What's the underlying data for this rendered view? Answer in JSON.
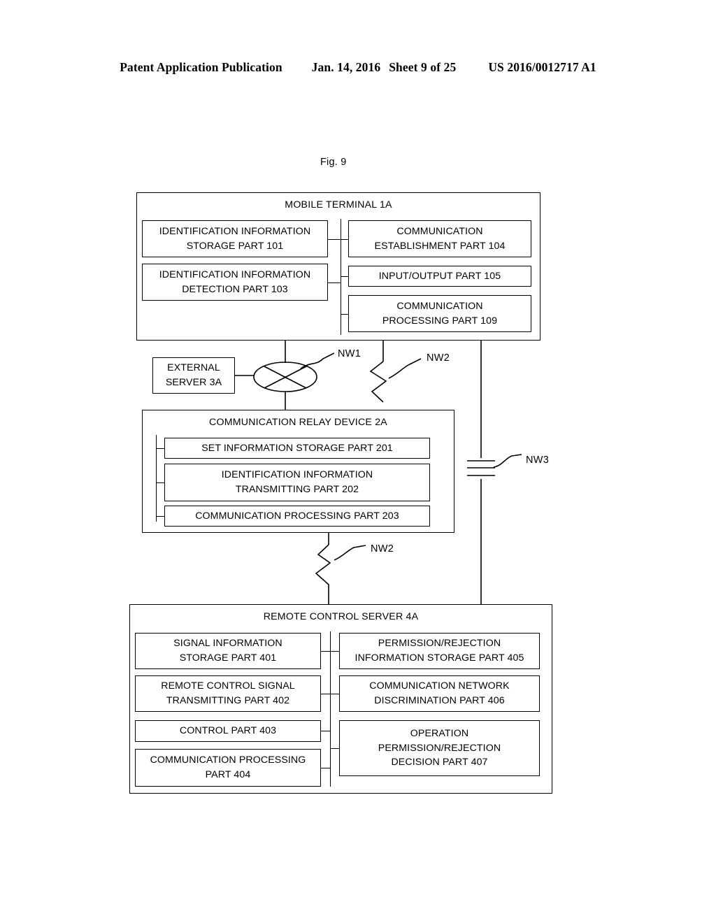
{
  "header": {
    "left": "Patent Application Publication",
    "date": "Jan. 14, 2016",
    "sheet": "Sheet 9 of 25",
    "doc_number": "US 2016/0012717 A1"
  },
  "figure": {
    "label": "Fig. 9"
  },
  "mobile_terminal": {
    "title": "MOBILE TERMINAL 1A",
    "left_units": [
      {
        "line1": "IDENTIFICATION INFORMATION",
        "line2": "STORAGE PART 101"
      },
      {
        "line1": "IDENTIFICATION INFORMATION",
        "line2": "DETECTION PART 103"
      }
    ],
    "right_units": [
      {
        "line1": "COMMUNICATION",
        "line2": "ESTABLISHMENT PART 104"
      },
      {
        "line1": "INPUT/OUTPUT PART 105",
        "line2": ""
      },
      {
        "line1": "COMMUNICATION",
        "line2": "PROCESSING PART 109"
      }
    ]
  },
  "external_server": {
    "line1": "EXTERNAL",
    "line2": "SERVER 3A"
  },
  "relay_device": {
    "title": "COMMUNICATION RELAY DEVICE 2A",
    "units": [
      {
        "line1": "SET INFORMATION STORAGE PART 201",
        "line2": ""
      },
      {
        "line1": "IDENTIFICATION INFORMATION",
        "line2": "TRANSMITTING PART 202"
      },
      {
        "line1": "COMMUNICATION PROCESSING PART 203",
        "line2": ""
      }
    ]
  },
  "remote_control_server": {
    "title": "REMOTE CONTROL SERVER 4A",
    "left_units": [
      {
        "line1": "SIGNAL INFORMATION",
        "line2": "STORAGE PART 401",
        "line3": ""
      },
      {
        "line1": "REMOTE CONTROL SIGNAL",
        "line2": "TRANSMITTING PART 402",
        "line3": ""
      },
      {
        "line1": "CONTROL PART 403",
        "line2": "",
        "line3": ""
      },
      {
        "line1": "COMMUNICATION PROCESSING",
        "line2": "PART 404",
        "line3": ""
      }
    ],
    "right_units": [
      {
        "line1": "PERMISSION/REJECTION",
        "line2": "INFORMATION STORAGE PART 405",
        "line3": ""
      },
      {
        "line1": "COMMUNICATION NETWORK",
        "line2": "DISCRIMINATION PART 406",
        "line3": ""
      },
      {
        "line1": "OPERATION",
        "line2": "PERMISSION/REJECTION",
        "line3": "DECISION PART 407"
      }
    ]
  },
  "networks": {
    "nw1": "NW1",
    "nw2_upper": "NW2",
    "nw2_lower": "NW2",
    "nw3": "NW3"
  },
  "colors": {
    "ink": "#000000",
    "paper": "#ffffff"
  }
}
